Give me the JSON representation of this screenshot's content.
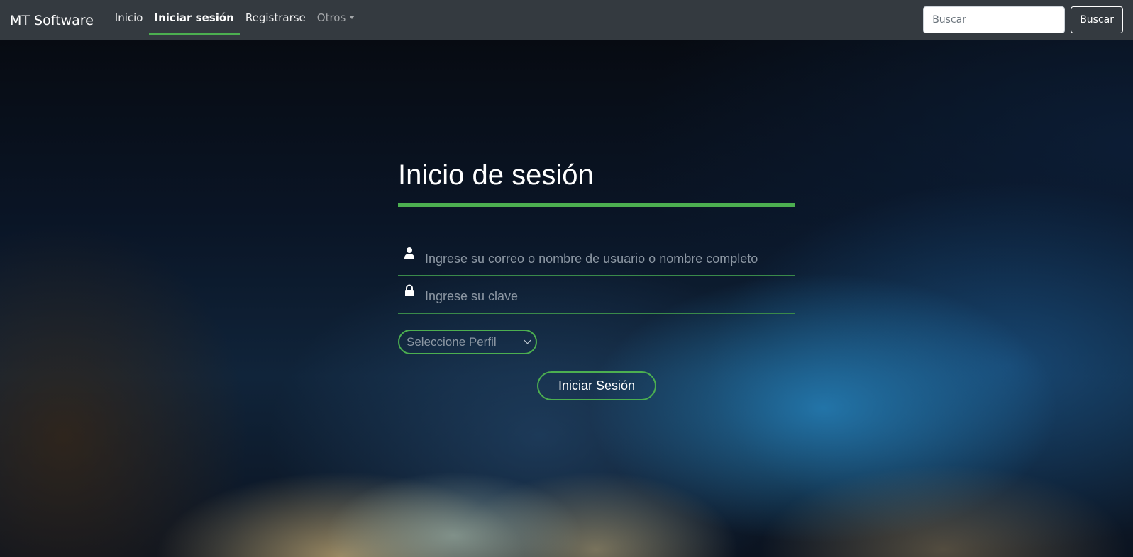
{
  "navbar": {
    "brand": "MT Software",
    "links": [
      {
        "label": "Inicio",
        "active": false
      },
      {
        "label": "Iniciar sesión",
        "active": true
      },
      {
        "label": "Registrarse",
        "active": false
      },
      {
        "label": "Otros",
        "active": false,
        "dropdown": true
      }
    ],
    "search": {
      "placeholder": "Buscar",
      "value": "",
      "button_label": "Buscar"
    }
  },
  "login": {
    "title": "Inicio de sesión",
    "user_field": {
      "placeholder": "Ingrese su correo o nombre de usuario o nombre completo",
      "value": "",
      "icon": "user-icon"
    },
    "password_field": {
      "placeholder": "Ingrese su clave",
      "value": "",
      "icon": "lock-icon"
    },
    "profile_select": {
      "selected": "Seleccione Perfil"
    },
    "submit_label": "Iniciar Sesión"
  },
  "colors": {
    "accent": "#4caf50",
    "navbar_bg": "#343a40",
    "text_light": "#ffffff"
  }
}
